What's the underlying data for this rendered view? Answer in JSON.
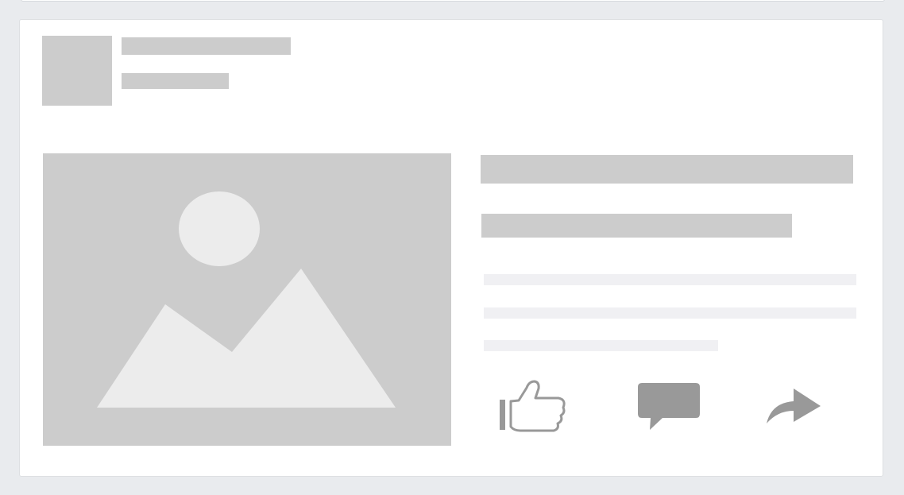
{
  "feed": {
    "post_placeholder": {
      "header": {
        "avatar": "placeholder",
        "name": "",
        "meta": ""
      },
      "media": {
        "icon": "image-placeholder-icon"
      },
      "content": {
        "title_lines": 2,
        "body_lines": 3
      },
      "actions": [
        {
          "name": "like",
          "icon": "thumbs-up-icon"
        },
        {
          "name": "comment",
          "icon": "speech-bubble-icon"
        },
        {
          "name": "share",
          "icon": "share-arrow-icon"
        }
      ]
    }
  },
  "colors": {
    "page_background": "#e9ebee",
    "card_background": "#ffffff",
    "placeholder_dark": "#cccccc",
    "placeholder_light": "#f0f0f3",
    "image_shapes": "#ececec",
    "action_icons": "#999999"
  }
}
